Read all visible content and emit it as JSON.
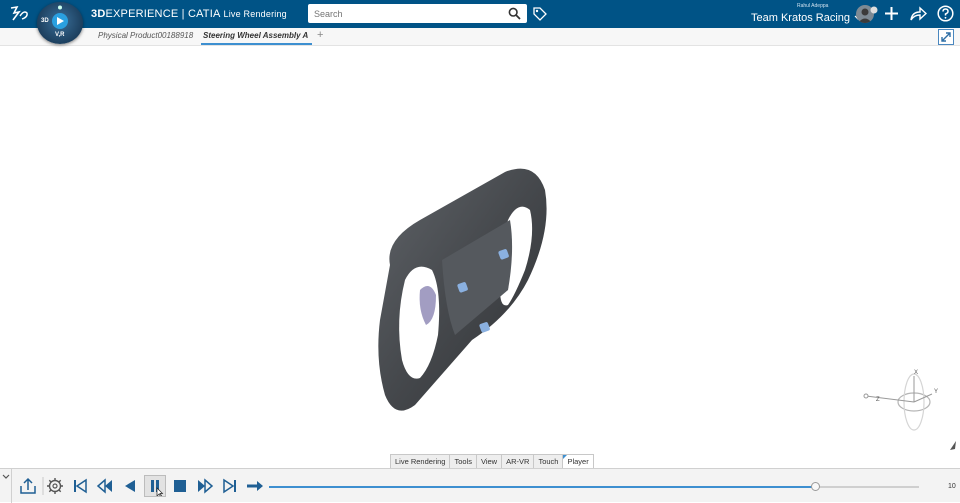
{
  "header": {
    "brand_bold": "3D",
    "brand_main": "EXPERIENCE | CATIA",
    "brand_app": "Live Rendering",
    "compass_label_3d": "3D",
    "compass_label_v": "V,R",
    "search_placeholder": "Search",
    "user_name": "Rahul Adeppa",
    "team_name": "Team Kratos Racing"
  },
  "tabs": [
    {
      "label": "Physical Product00188918",
      "active": false
    },
    {
      "label": "Steering Wheel Assembly A",
      "active": true
    }
  ],
  "tab_add": "+",
  "section_tabs": [
    {
      "label": "Live Rendering",
      "active": false
    },
    {
      "label": "Tools",
      "active": false
    },
    {
      "label": "View",
      "active": false
    },
    {
      "label": "AR-VR",
      "active": false
    },
    {
      "label": "Touch",
      "active": false
    },
    {
      "label": "Player",
      "active": true
    }
  ],
  "player": {
    "slider_max": "10",
    "slider_fraction": 0.84
  },
  "compass_axes": {
    "x": "X",
    "y": "Y",
    "z": "Z"
  },
  "icons": {
    "app": "3ds-logo-icon",
    "search": "search-icon",
    "tag": "tag-icon",
    "add": "plus-icon",
    "share": "share-icon",
    "help": "help-icon"
  },
  "colors": {
    "topbar": "#005386",
    "accent": "#3d8fd0",
    "model": "#4b4e52"
  }
}
